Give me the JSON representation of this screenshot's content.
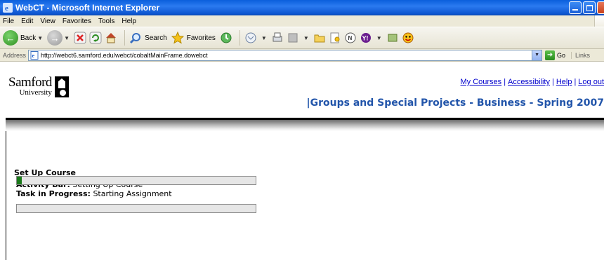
{
  "window": {
    "title": "WebCT - Microsoft Internet Explorer"
  },
  "menu": [
    "File",
    "Edit",
    "View",
    "Favorites",
    "Tools",
    "Help"
  ],
  "toolbar": {
    "back_label": "Back",
    "search_label": "Search",
    "favorites_label": "Favorites"
  },
  "address": {
    "label": "Address",
    "url": "http://webct6.samford.edu/webct/cobaltMainFrame.dowebct",
    "go_label": "Go",
    "links_label": "Links"
  },
  "site": {
    "logo_name": "Samford",
    "logo_sub": "University",
    "top_links": [
      "My Courses",
      "Accessibility",
      "Help",
      "Log out"
    ],
    "course_title": "|Groups and Special Projects - Business - Spring 2007"
  },
  "content": {
    "heading": "Set Up Course",
    "activity_label": "Activity Bar:",
    "activity_value": "Setting Up Course",
    "activity_progress": 0.006,
    "task_label": "Task in Progress:",
    "task_value": "Starting Assignment",
    "task_progress": 0.1
  },
  "colors": {
    "title_bar": "#0a5fdc",
    "link": "#0000cc",
    "course_title": "#2255aa",
    "activity_fill": "#1a7a1a",
    "task_fill": "#2565e0"
  }
}
